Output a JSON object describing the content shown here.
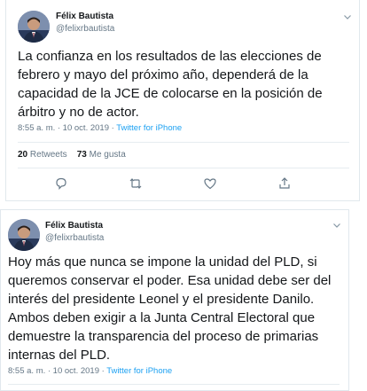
{
  "tweets": [
    {
      "author_name": "Félix Bautista",
      "author_handle": "@felixrbautista",
      "text": "La confianza en los resultados de las elecciones de\nfebrero y mayo del próximo año, dependerá de la\ncapacidad de la JCE de colocarse en la posición de\nárbitro y no de actor.",
      "time": "8:55 a. m. · 10 oct. 2019 ·",
      "source": "Twitter for iPhone",
      "retweets_count": "20",
      "retweets_label": "Retweets",
      "likes_count": "73",
      "likes_label": "Me gusta"
    },
    {
      "author_name": "Félix Bautista",
      "author_handle": "@felixrbautista",
      "text": "Hoy más que nunca se impone la unidad del PLD, si\nqueremos conservar el poder. Esa unidad debe ser del\ninterés del presidente Leonel y el presidente Danilo.\nAmbos deben exigir a la Junta Central Electoral que\ndemuestre la transparencia del proceso de primarias\ninternas del PLD.",
      "time": "8:55 a. m. · 10 oct. 2019 ·",
      "source": "Twitter for iPhone"
    }
  ],
  "icons": {
    "reply": "reply-icon",
    "retweet": "retweet-icon",
    "like": "heart-icon",
    "share": "share-icon",
    "more": "chevron-down-icon"
  },
  "colors": {
    "link": "#1da1f2",
    "secondary_text": "#657786",
    "border": "#e1e8ed"
  }
}
